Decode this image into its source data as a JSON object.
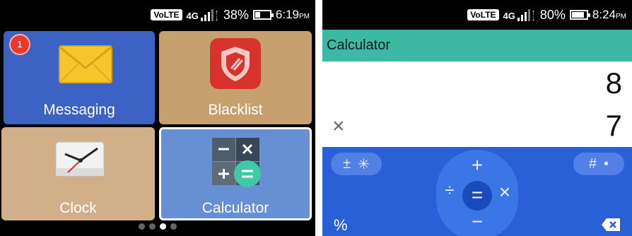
{
  "left": {
    "status": {
      "volte": "VoLTE",
      "network": "4G",
      "battery": "38%",
      "battery_level": 0.38,
      "time": "6:19",
      "ampm": "PM"
    },
    "tiles": [
      {
        "label": "Messaging",
        "color": "#3c62c3",
        "icon": "envelope-icon",
        "badge": "1"
      },
      {
        "label": "Blacklist",
        "color": "#c7a06f",
        "icon": "shield-block-icon"
      },
      {
        "label": "Clock",
        "color": "#d1b089",
        "icon": "clock-icon"
      },
      {
        "label": "Calculator",
        "color": "#668fd4",
        "icon": "calculator-icon",
        "selected": true
      }
    ],
    "page_dots": {
      "count": 4,
      "active": 3
    }
  },
  "right": {
    "status": {
      "volte": "VoLTE",
      "network": "4G",
      "battery": "80%",
      "battery_level": 0.8,
      "time": "8:24",
      "ampm": "PM"
    },
    "app_title": "Calculator",
    "accent": "#3cb8a4",
    "display": {
      "result": "8",
      "operator": "×",
      "entry": "7"
    },
    "keys": {
      "sign": "±",
      "sign_alt": "✳",
      "hash": "#",
      "dot": "•",
      "plus": "+",
      "minus": "−",
      "divide": "÷",
      "times": "×",
      "equals": "=",
      "percent": "%"
    }
  }
}
